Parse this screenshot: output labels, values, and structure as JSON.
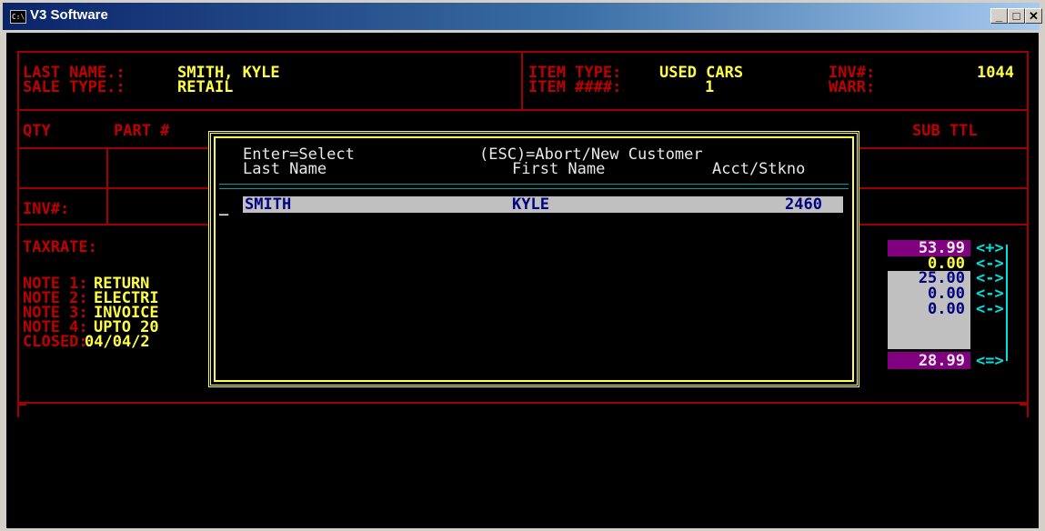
{
  "window": {
    "title": "V3 Software",
    "icon_text": "C:\\",
    "minimize_glyph": "_",
    "maximize_glyph": "□",
    "close_glyph": "✕"
  },
  "header": {
    "last_name_label": "LAST NAME.:",
    "last_name_value": "SMITH, KYLE",
    "sale_type_label": "SALE TYPE.:",
    "sale_type_value": "RETAIL",
    "item_type_label": "ITEM TYPE:",
    "item_type_value": "USED CARS",
    "item_num_label": "ITEM ####:",
    "item_num_value": "1",
    "inv_label": "INV#:",
    "inv_value": "1044",
    "warr_label": "WARR:"
  },
  "columns": {
    "qty": "QTY",
    "part": "PART #",
    "subttl": "SUB TTL"
  },
  "fields": {
    "inv_label": "INV#:",
    "taxrate_label": "TAXRATE:"
  },
  "notes": [
    {
      "label": "NOTE 1:",
      "value": "RETURN"
    },
    {
      "label": "NOTE 2:",
      "value": "ELECTRI"
    },
    {
      "label": "NOTE 3:",
      "value": "INVOICE"
    },
    {
      "label": "NOTE 4:",
      "value": "UPTO 20"
    }
  ],
  "closed": {
    "label": "CLOSED:",
    "value": "04/04/2"
  },
  "totals": [
    {
      "value": "53.99",
      "op": "<+>"
    },
    {
      "value": "0.00",
      "op": "<->"
    },
    {
      "value": "25.00",
      "op": "<->"
    },
    {
      "value": "0.00",
      "op": "<->"
    },
    {
      "value": "0.00",
      "op": "<->"
    },
    {
      "value": "28.99",
      "op": "<=>"
    }
  ],
  "popup": {
    "hint_select": "Enter=Select",
    "hint_abort": "(ESC)=Abort/New Customer",
    "col_last": "Last Name",
    "col_first": "First Name",
    "col_acct": "Acct/Stkno",
    "cursor": "_",
    "rows": [
      {
        "last": "SMITH",
        "first": "KYLE",
        "acct": "2460"
      }
    ]
  },
  "colors": {
    "border": "#a00000",
    "label": "#c00000",
    "value": "#ffff40",
    "highlight_row": "#c0c0c0",
    "highlight_text": "#000080",
    "magenta_bg": "#800080",
    "light_bg": "#c0c0c0",
    "cyan": "#00e0e0"
  }
}
